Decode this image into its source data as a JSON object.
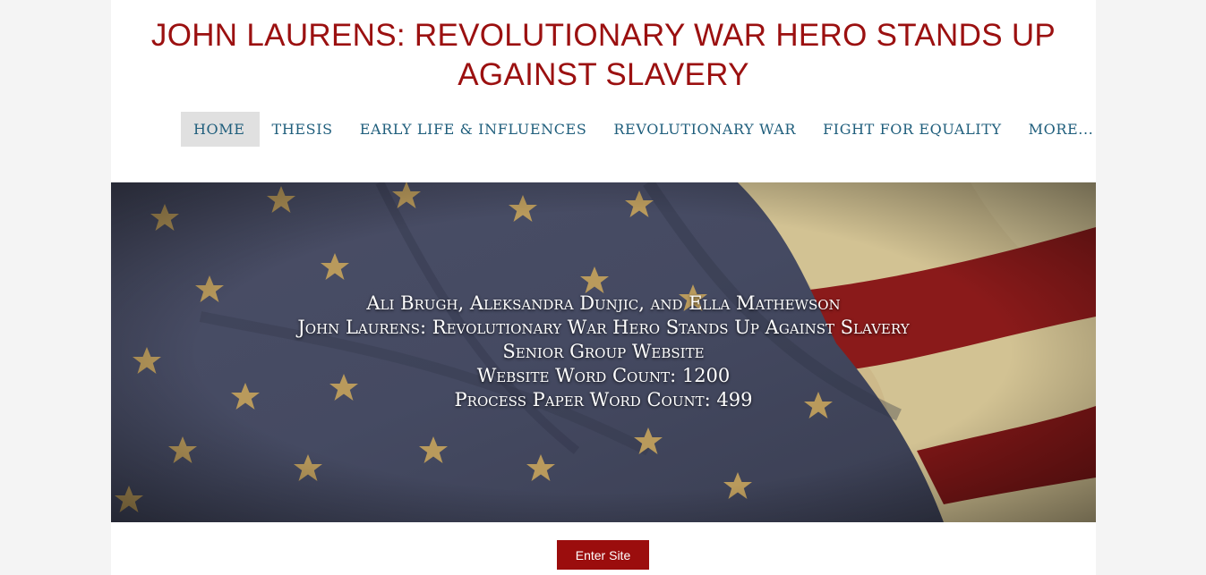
{
  "site": {
    "title": "JOHN LAURENS: REVOLUTIONARY WAR HERO STANDS UP AGAINST SLAVERY"
  },
  "nav": {
    "items": [
      {
        "label": "HOME",
        "active": true
      },
      {
        "label": "THESIS"
      },
      {
        "label": "EARLY LIFE & INFLUENCES"
      },
      {
        "label": "REVOLUTIONARY WAR"
      },
      {
        "label": "FIGHT FOR EQUALITY"
      },
      {
        "label": "MORE..."
      }
    ]
  },
  "hero": {
    "lines": [
      "Ali Brugh, Aleksandra Dunjic, and Ella Mathewson",
      "John Laurens: Revolutionary War Hero Stands Up Against Slavery",
      "Senior Group Website",
      "Website Word Count: 1200",
      "Process Paper Word Count: 499"
    ]
  },
  "cta": {
    "label": "Enter Site"
  },
  "colors": {
    "title": "#9b1010",
    "nav_text": "#1f5e7c",
    "nav_active_bg": "#e0e0e0",
    "button_bg": "#9b0d0d"
  }
}
